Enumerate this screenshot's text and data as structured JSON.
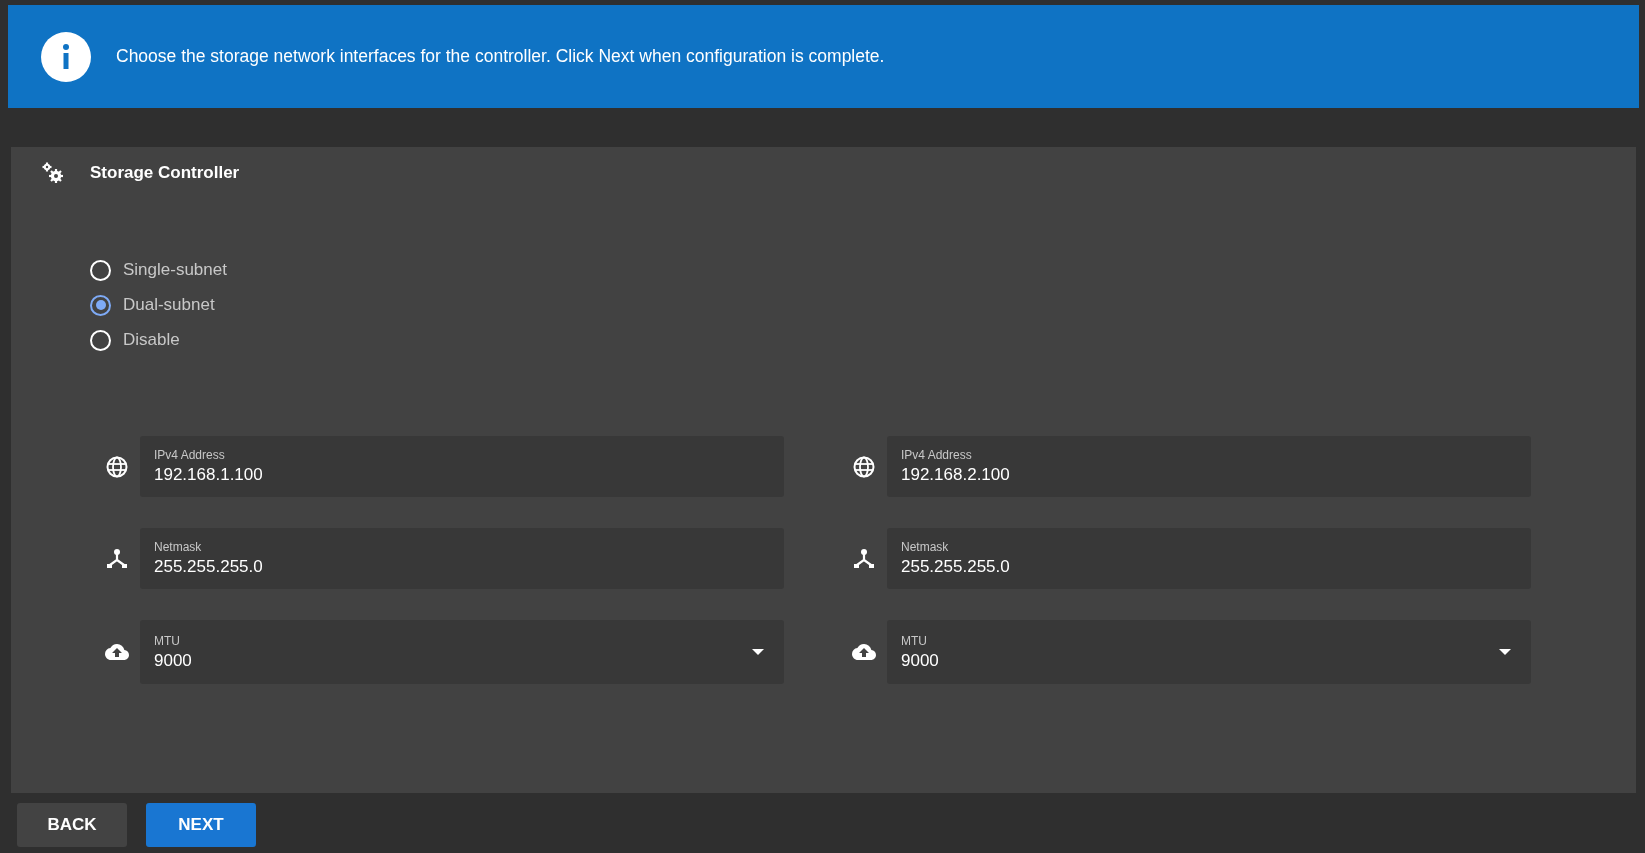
{
  "banner": {
    "message": "Choose the storage network interfaces for the controller. Click Next when configuration is complete."
  },
  "card": {
    "title": "Storage Controller"
  },
  "mode_options": [
    {
      "label": "Single-subnet",
      "selected": false
    },
    {
      "label": "Dual-subnet",
      "selected": true
    },
    {
      "label": "Disable",
      "selected": false
    }
  ],
  "subnets": [
    {
      "fields": [
        {
          "kind": "address",
          "label": "IPv4 Address",
          "value": "192.168.1.100"
        },
        {
          "kind": "netmask",
          "label": "Netmask",
          "value": "255.255.255.0"
        },
        {
          "kind": "mtu",
          "label": "MTU",
          "value": "9000"
        }
      ]
    },
    {
      "fields": [
        {
          "kind": "address",
          "label": "IPv4 Address",
          "value": "192.168.2.100"
        },
        {
          "kind": "netmask",
          "label": "Netmask",
          "value": "255.255.255.0"
        },
        {
          "kind": "mtu",
          "label": "MTU",
          "value": "9000"
        }
      ]
    }
  ],
  "buttons": [
    {
      "label": "BACK",
      "kind": "secondary"
    },
    {
      "label": "NEXT",
      "kind": "primary"
    }
  ]
}
